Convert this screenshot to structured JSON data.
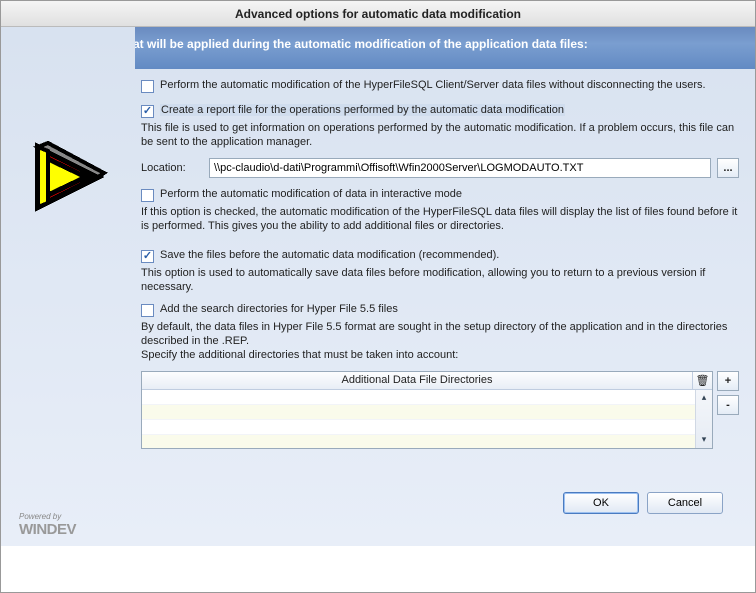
{
  "window": {
    "title": "Advanced options for automatic data modification"
  },
  "header": {
    "text": "Select the options that will be applied during the automatic modification of the application data files:"
  },
  "sidebar": {
    "powered_line1": "Powered by",
    "powered_line2": "WINDEV"
  },
  "options": {
    "opt1": {
      "checked": false,
      "label": "Perform the automatic modification of the HyperFileSQL Client/Server data files without disconnecting the users."
    },
    "opt2": {
      "checked": true,
      "label": "Create a report file for the operations performed by the automatic data modification",
      "desc": "This file is used to get information on operations performed by the automatic modification. If a problem occurs, this file can be sent to the application manager.",
      "location_label": "Location:",
      "location_value": "\\\\pc-claudio\\d-dati\\Programmi\\Offisoft\\Wfin2000Server\\LOGMODAUTO.TXT",
      "browse": "..."
    },
    "opt3": {
      "checked": false,
      "label": "Perform the automatic modification of data in interactive mode",
      "desc": "If this option is checked, the automatic modification of the HyperFileSQL data files will display the list of files found before it is performed. This gives you the ability to add additional files or directories."
    },
    "opt4": {
      "checked": true,
      "label": "Save the files before the automatic data modification (recommended).",
      "desc": "This option is used to automatically save data files before modification, allowing you to return to a previous version if necessary."
    },
    "opt5": {
      "checked": false,
      "label": "Add the search directories for Hyper File 5.5 files",
      "desc": "By default, the data files in Hyper File 5.5 format are sought in the setup directory of the application and in the directories described in the .REP.\nSpecify the additional directories that must be taken into account:"
    }
  },
  "table": {
    "header": "Additional Data File Directories",
    "rows": []
  },
  "buttons": {
    "add": "+",
    "remove": "-",
    "ok": "OK",
    "cancel": "Cancel"
  }
}
